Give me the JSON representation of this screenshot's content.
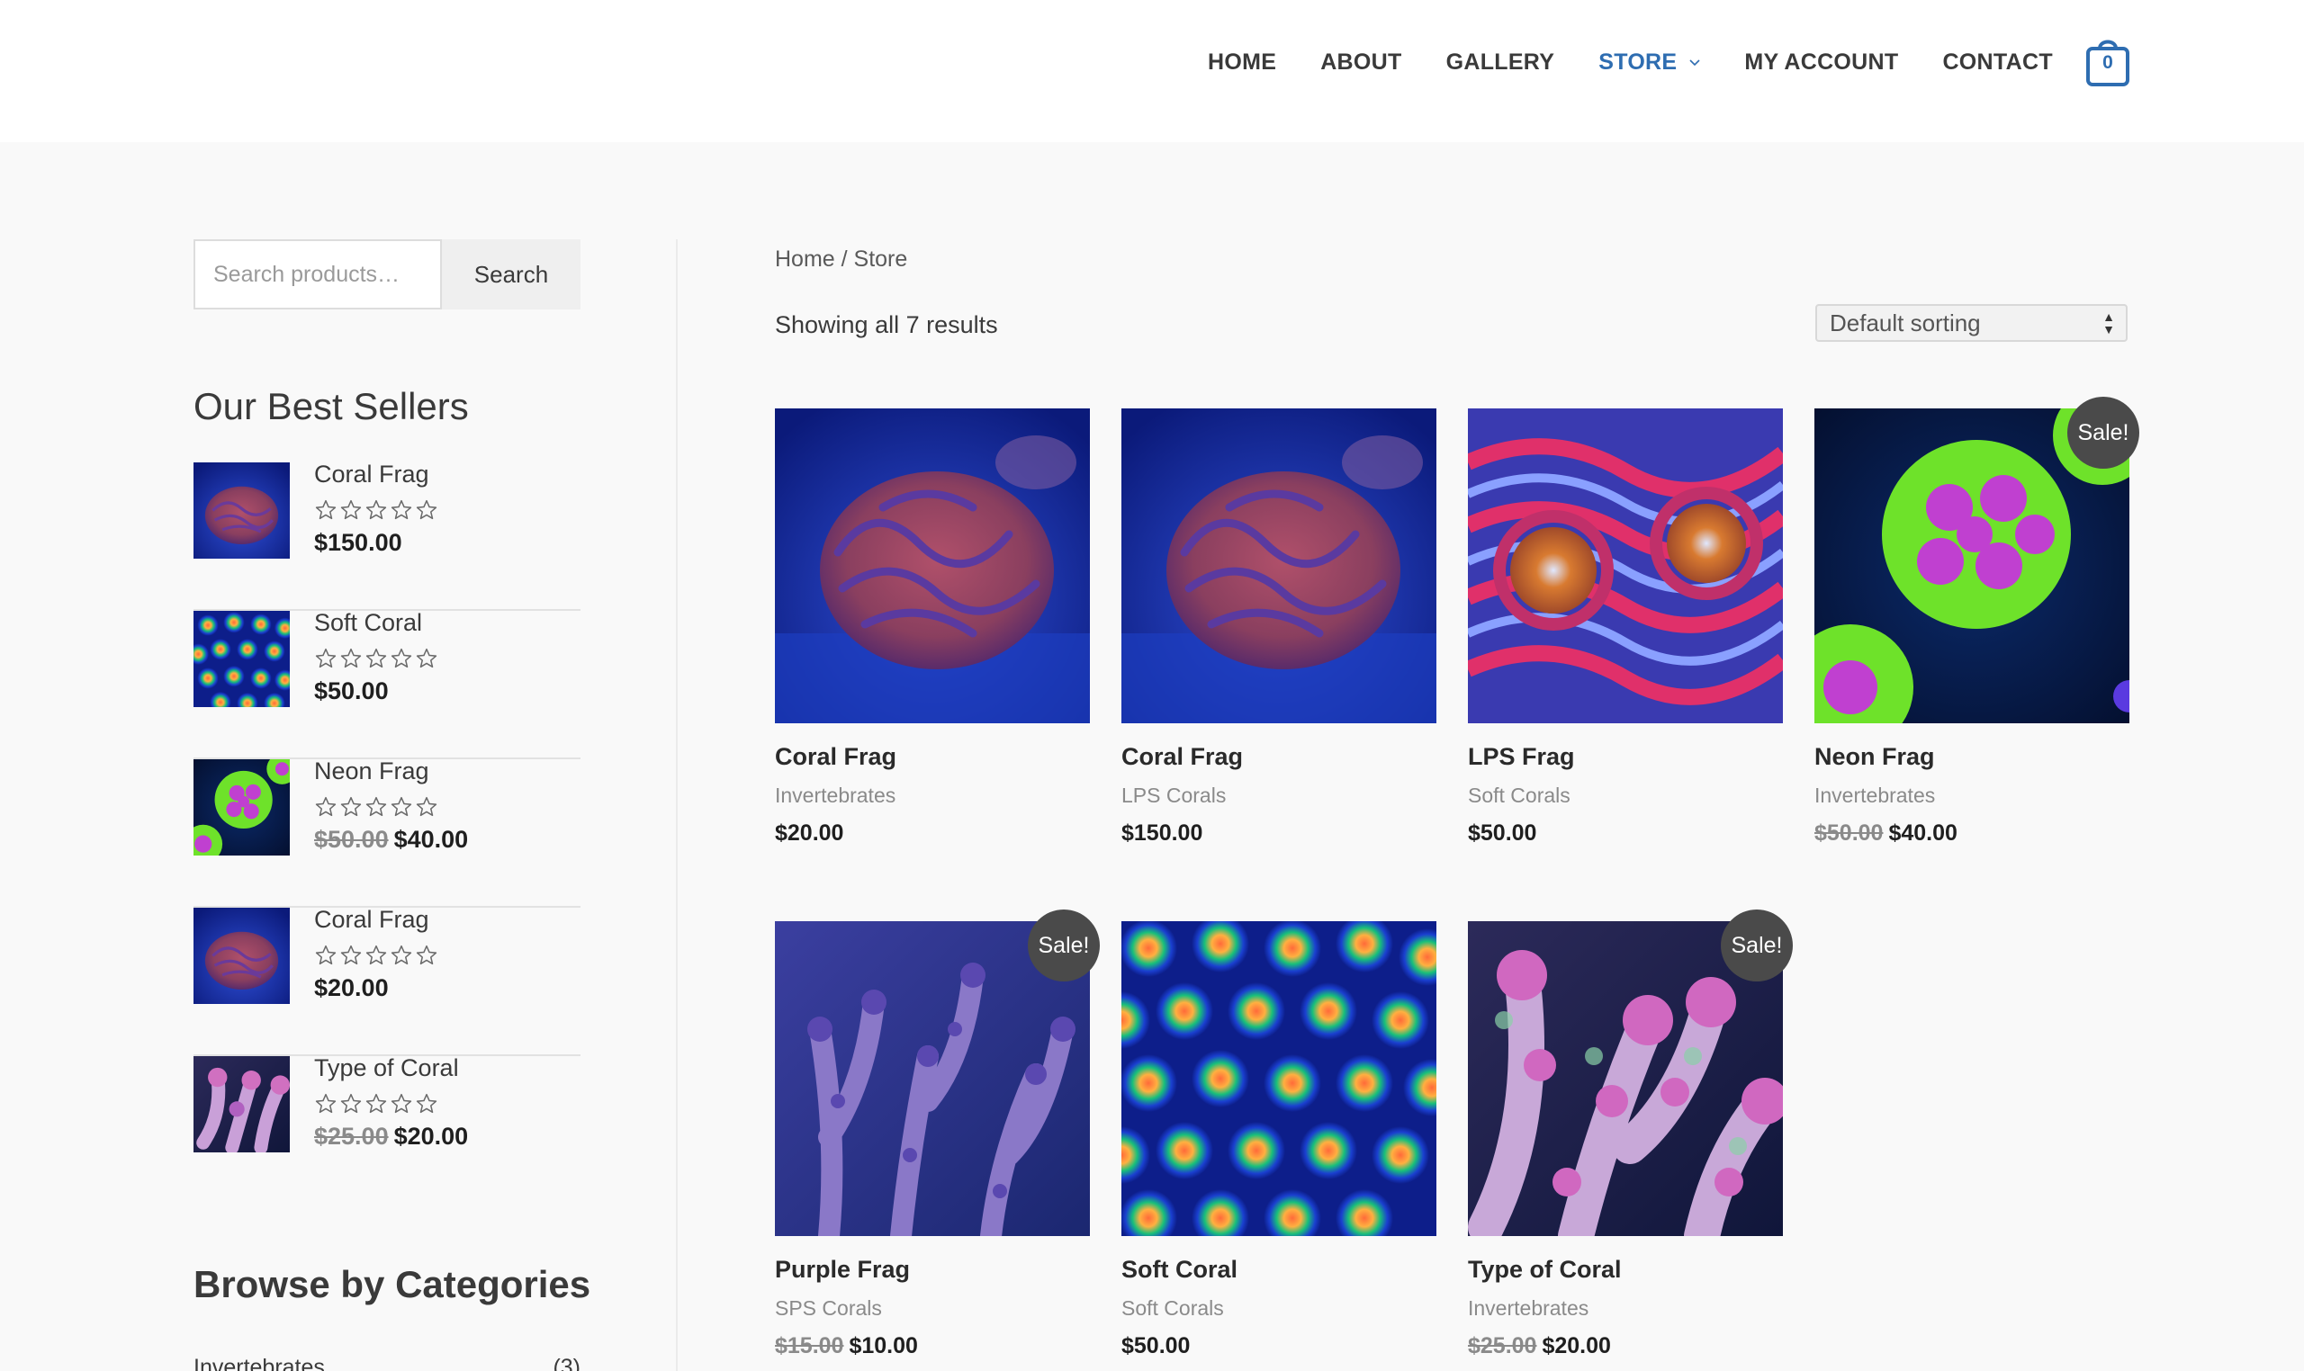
{
  "nav": {
    "items": [
      {
        "label": "HOME"
      },
      {
        "label": "ABOUT"
      },
      {
        "label": "GALLERY"
      },
      {
        "label": "STORE"
      },
      {
        "label": "MY ACCOUNT"
      },
      {
        "label": "CONTACT"
      }
    ],
    "active": "STORE",
    "cart_count": "0",
    "accent_color": "#2e6db1"
  },
  "sidebar": {
    "search": {
      "placeholder": "Search products…",
      "button": "Search"
    },
    "best_sellers_title": "Our Best Sellers",
    "best_sellers": [
      {
        "name": "Coral Frag",
        "old_price": "",
        "price": "$150.00",
        "rating": 0
      },
      {
        "name": "Soft Coral",
        "old_price": "",
        "price": "$50.00",
        "rating": 0
      },
      {
        "name": "Neon Frag",
        "old_price": "$50.00",
        "price": "$40.00",
        "rating": 0
      },
      {
        "name": "Coral Frag",
        "old_price": "",
        "price": "$20.00",
        "rating": 0
      },
      {
        "name": "Type of Coral",
        "old_price": "$25.00",
        "price": "$20.00",
        "rating": 0
      }
    ],
    "browse_title": "Browse by Categories",
    "categories": [
      {
        "name": "Invertebrates",
        "count": "(3)"
      }
    ]
  },
  "main": {
    "breadcrumb": {
      "home": "Home",
      "sep": " / ",
      "current": "Store"
    },
    "result_count": "Showing all 7 results",
    "sorting": "Default sorting",
    "sale_badge": "Sale!",
    "products": [
      {
        "title": "Coral Frag",
        "category": "Invertebrates",
        "old_price": "",
        "price": "$20.00",
        "sale": false
      },
      {
        "title": "Coral Frag",
        "category": "LPS Corals",
        "old_price": "",
        "price": "$150.00",
        "sale": false
      },
      {
        "title": "LPS Frag",
        "category": "Soft Corals",
        "old_price": "",
        "price": "$50.00",
        "sale": false
      },
      {
        "title": "Neon Frag",
        "category": "Invertebrates",
        "old_price": "$50.00",
        "price": "$40.00",
        "sale": true
      },
      {
        "title": "Purple Frag",
        "category": "SPS Corals",
        "old_price": "$15.00",
        "price": "$10.00",
        "sale": true
      },
      {
        "title": "Soft Coral",
        "category": "Soft Corals",
        "old_price": "",
        "price": "$50.00",
        "sale": false
      },
      {
        "title": "Type of Coral",
        "category": "Invertebrates",
        "old_price": "$25.00",
        "price": "$20.00",
        "sale": true
      }
    ]
  }
}
